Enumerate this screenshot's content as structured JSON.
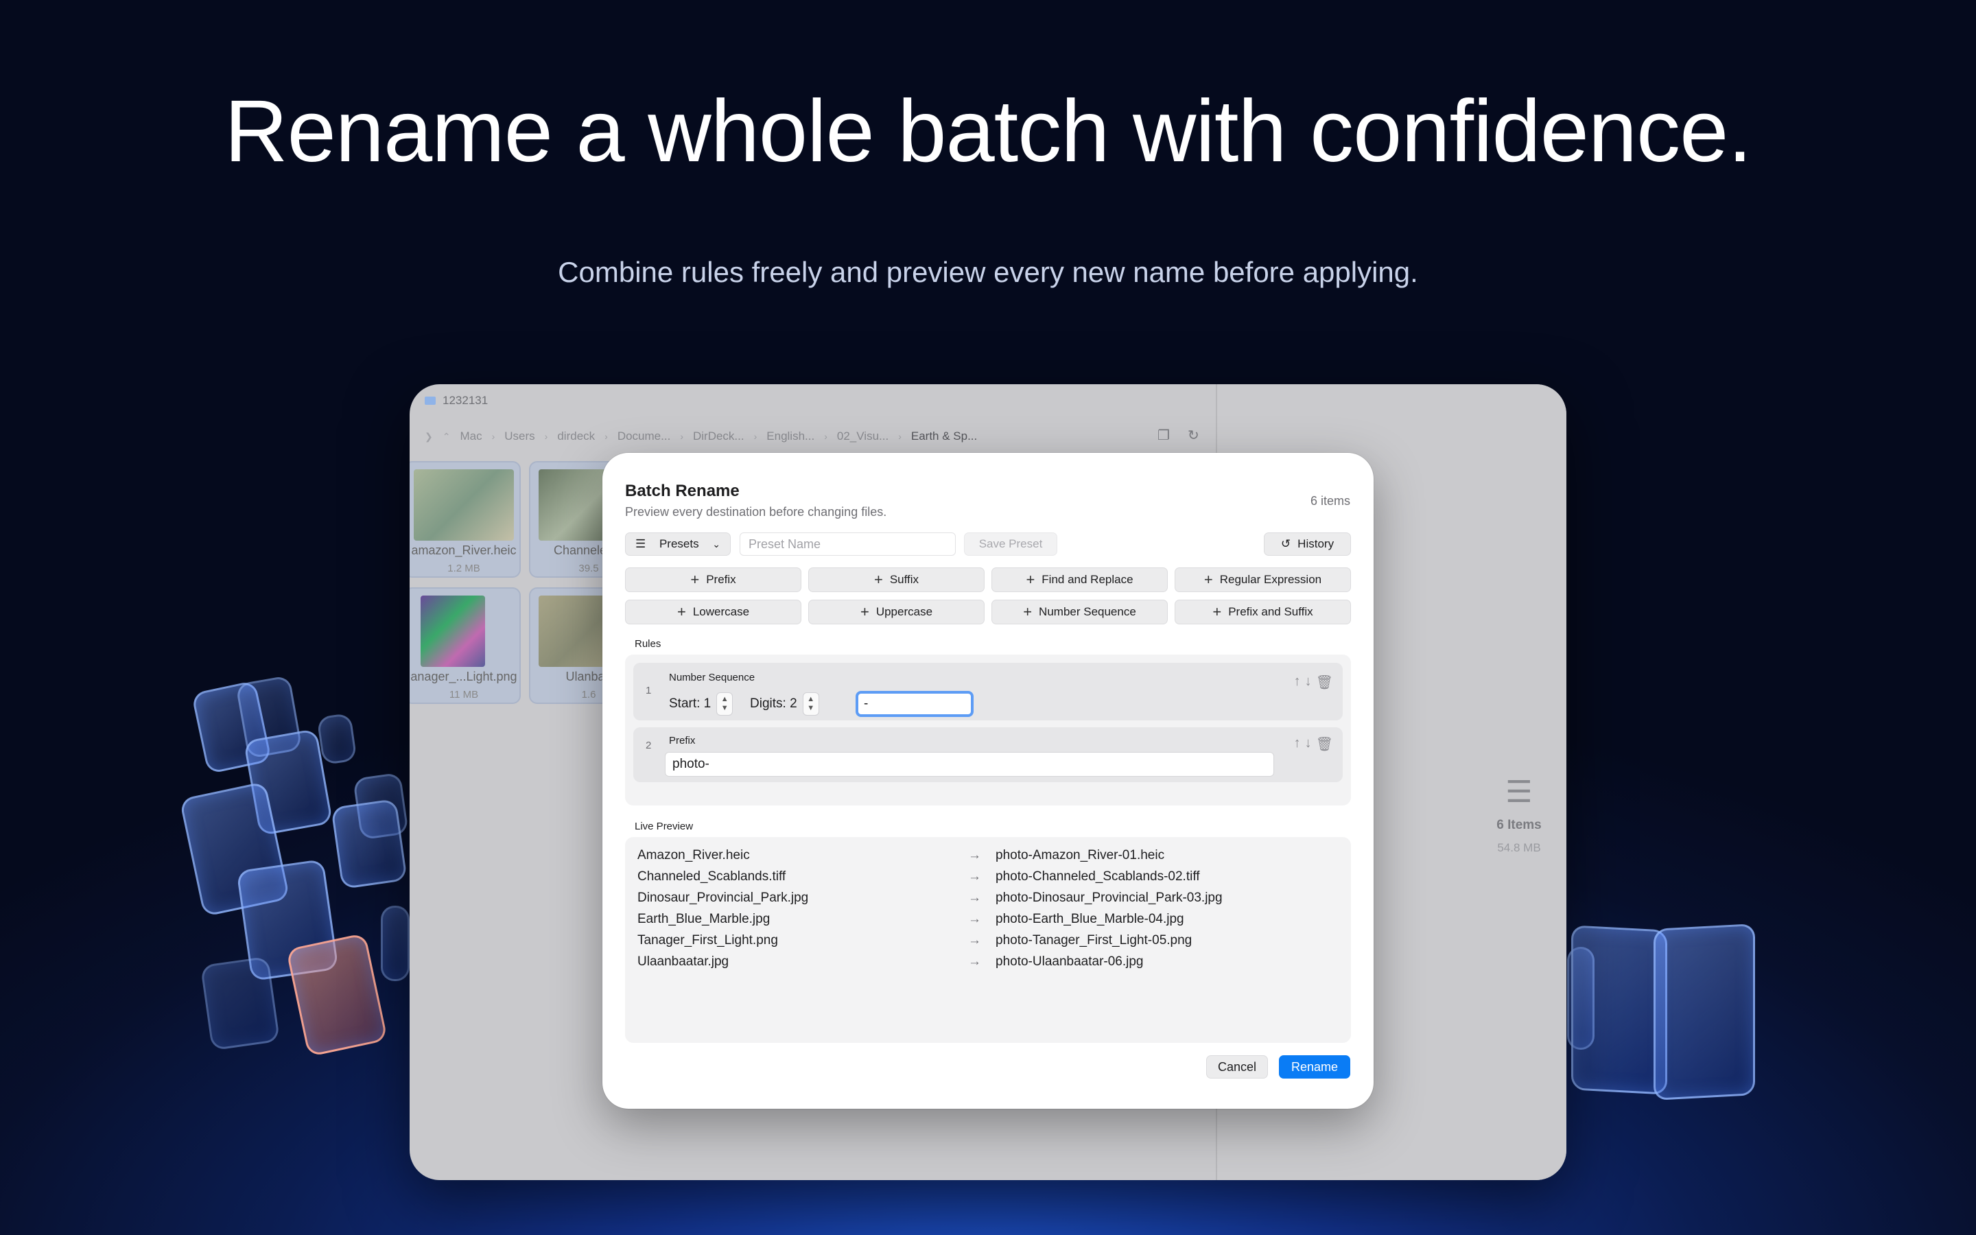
{
  "hero": {
    "title": "Rename a whole batch with confidence.",
    "subtitle": "Combine rules freely and preview every new name before applying."
  },
  "window": {
    "title": "1232131",
    "path": [
      "Mac",
      "Users",
      "dirdeck",
      "Docume...",
      "DirDeck...",
      "English...",
      "02_Visu...",
      "Earth & Sp..."
    ],
    "thumbnails": [
      {
        "name": "amazon_River.heic",
        "size": "1.2 MB",
        "color": "#8fa58a"
      },
      {
        "name": "Channele...b",
        "size": "39.5",
        "color": "#7c8c74"
      },
      {
        "name": "anager_...Light.png",
        "size": "11 MB",
        "color": "#5a4f8a"
      },
      {
        "name": "Ulanbaa",
        "size": "1.6",
        "color": "#9a9a80"
      }
    ],
    "side": {
      "count": "6 Items",
      "size": "54.8 MB"
    }
  },
  "dialog": {
    "title": "Batch Rename",
    "subtitle": "Preview every destination before changing files.",
    "item_count": "6 items",
    "presets_label": "Presets",
    "preset_name_placeholder": "Preset Name",
    "save_preset_label": "Save Preset",
    "history_label": "History",
    "rule_buttons": [
      "Prefix",
      "Suffix",
      "Find and Replace",
      "Regular Expression",
      "Lowercase",
      "Uppercase",
      "Number Sequence",
      "Prefix and Suffix"
    ],
    "rules_label": "Rules",
    "rules": [
      {
        "index": "1",
        "name": "Number Sequence",
        "start_label": "Start: 1",
        "digits_label": "Digits: 2",
        "separator_value": "-"
      },
      {
        "index": "2",
        "name": "Prefix",
        "value": "photo-"
      }
    ],
    "preview_label": "Live Preview",
    "preview": [
      {
        "old": "Amazon_River.heic",
        "new": "photo-Amazon_River-01.heic"
      },
      {
        "old": "Channeled_Scablands.tiff",
        "new": "photo-Channeled_Scablands-02.tiff"
      },
      {
        "old": "Dinosaur_Provincial_Park.jpg",
        "new": "photo-Dinosaur_Provincial_Park-03.jpg"
      },
      {
        "old": "Earth_Blue_Marble.jpg",
        "new": "photo-Earth_Blue_Marble-04.jpg"
      },
      {
        "old": "Tanager_First_Light.png",
        "new": "photo-Tanager_First_Light-05.png"
      },
      {
        "old": "Ulaanbaatar.jpg",
        "new": "photo-Ulaanbaatar-06.jpg"
      }
    ],
    "cancel_label": "Cancel",
    "rename_label": "Rename"
  },
  "colors": {
    "accent": "#0a7cf5",
    "focus_ring": "#5d9cf5"
  }
}
